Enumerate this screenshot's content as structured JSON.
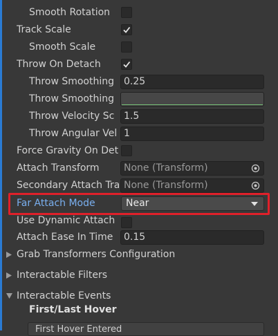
{
  "rows": {
    "smooth_rotation": {
      "label": "Smooth Rotation",
      "checked": false
    },
    "track_scale": {
      "label": "Track Scale",
      "checked": true
    },
    "smooth_scale": {
      "label": "Smooth Scale",
      "checked": false
    },
    "throw_on_detach": {
      "label": "Throw On Detach",
      "checked": true
    },
    "throw_smoothing_duration": {
      "label": "Throw Smoothing",
      "value": "0.25"
    },
    "throw_smoothing_curve": {
      "label": "Throw Smoothing"
    },
    "throw_velocity_scale": {
      "label": "Throw Velocity Sc",
      "value": "1.5"
    },
    "throw_angular_velocity": {
      "label": "Throw Angular Vel",
      "value": "1"
    },
    "force_gravity": {
      "label": "Force Gravity On Det",
      "checked": false
    },
    "attach_transform": {
      "label": "Attach Transform",
      "value": "None (Transform)"
    },
    "secondary_attach": {
      "label": "Secondary Attach Tra",
      "value": "None (Transform)"
    },
    "far_attach_mode": {
      "label": "Far Attach Mode",
      "value": "Near"
    },
    "use_dynamic_attach": {
      "label": "Use Dynamic Attach",
      "checked": false
    },
    "attach_ease": {
      "label": "Attach Ease In Time",
      "value": "0.15"
    }
  },
  "foldouts": {
    "grab_transformers": {
      "label": "Grab Transformers Configuration",
      "expanded": false
    },
    "interactable_filters": {
      "label": "Interactable Filters",
      "expanded": false
    },
    "interactable_events": {
      "label": "Interactable Events",
      "expanded": true
    }
  },
  "events": {
    "subheading": "First/Last Hover",
    "first_item": "First Hover Entered"
  },
  "colors": {
    "highlight": "#e0202a",
    "focused_label": "#7ab0f0",
    "selection_bar": "#2a7bd4"
  }
}
